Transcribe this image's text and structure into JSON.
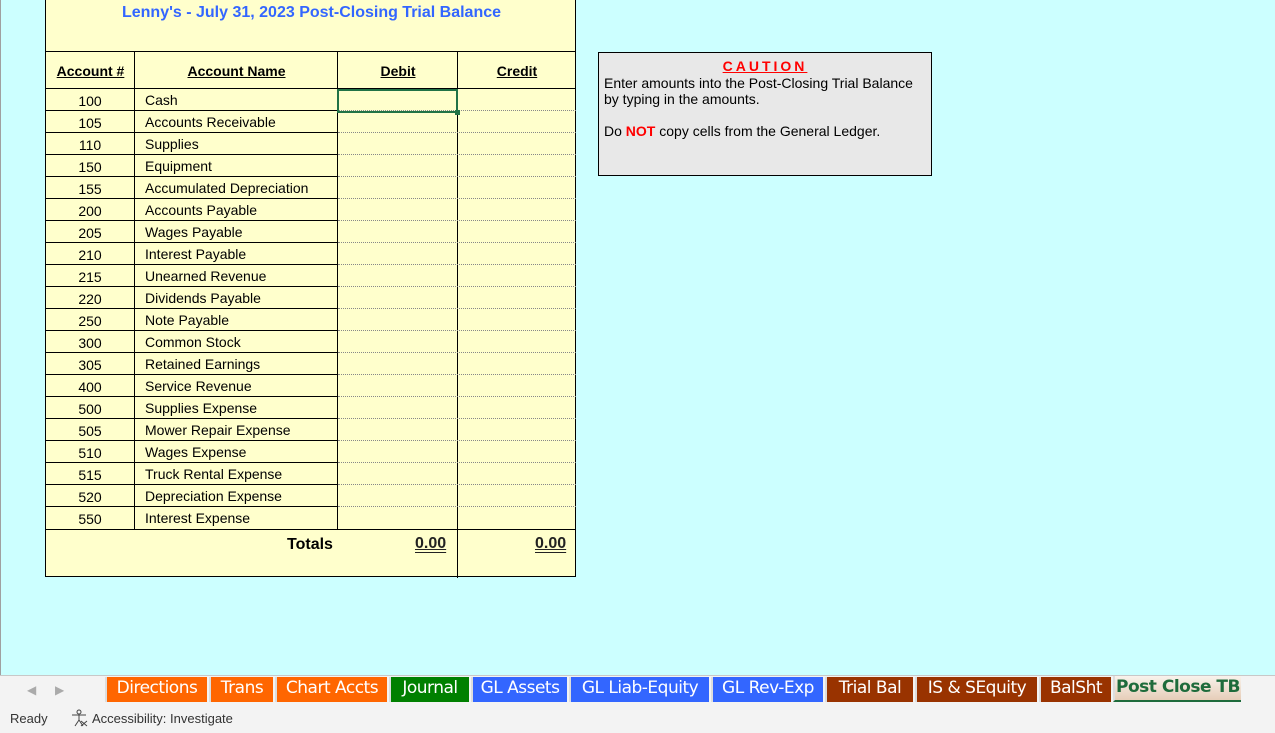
{
  "sheet": {
    "title": "Lenny's  -  July 31, 2023  Post-Closing Trial Balance",
    "headers": {
      "account_num": "Account #",
      "account_name": "Account Name",
      "debit": "Debit",
      "credit": "Credit"
    },
    "rows": [
      {
        "num": "100",
        "name": "Cash",
        "debit": "",
        "credit": ""
      },
      {
        "num": "105",
        "name": "Accounts Receivable",
        "debit": "",
        "credit": ""
      },
      {
        "num": "110",
        "name": "Supplies",
        "debit": "",
        "credit": ""
      },
      {
        "num": "150",
        "name": "Equipment",
        "debit": "",
        "credit": ""
      },
      {
        "num": "155",
        "name": "Accumulated Depreciation",
        "debit": "",
        "credit": ""
      },
      {
        "num": "200",
        "name": "Accounts Payable",
        "debit": "",
        "credit": ""
      },
      {
        "num": "205",
        "name": "Wages Payable",
        "debit": "",
        "credit": ""
      },
      {
        "num": "210",
        "name": "Interest Payable",
        "debit": "",
        "credit": ""
      },
      {
        "num": "215",
        "name": "Unearned Revenue",
        "debit": "",
        "credit": ""
      },
      {
        "num": "220",
        "name": "Dividends Payable",
        "debit": "",
        "credit": ""
      },
      {
        "num": "250",
        "name": "Note Payable",
        "debit": "",
        "credit": ""
      },
      {
        "num": "300",
        "name": "Common Stock",
        "debit": "",
        "credit": ""
      },
      {
        "num": "305",
        "name": "Retained Earnings",
        "debit": "",
        "credit": ""
      },
      {
        "num": "400",
        "name": "Service Revenue",
        "debit": "",
        "credit": ""
      },
      {
        "num": "500",
        "name": "Supplies Expense",
        "debit": "",
        "credit": ""
      },
      {
        "num": "505",
        "name": "Mower Repair Expense",
        "debit": "",
        "credit": ""
      },
      {
        "num": "510",
        "name": "Wages Expense",
        "debit": "",
        "credit": ""
      },
      {
        "num": "515",
        "name": "Truck Rental Expense",
        "debit": "",
        "credit": ""
      },
      {
        "num": "520",
        "name": "Depreciation Expense",
        "debit": "",
        "credit": ""
      },
      {
        "num": "550",
        "name": "Interest Expense",
        "debit": "",
        "credit": ""
      }
    ],
    "totals_label": "Totals",
    "total_debit": "0.00",
    "total_credit": "0.00"
  },
  "caution": {
    "title": "CAUTION",
    "line1": "Enter amounts into the Post-Closing Trial Balance by typing in the amounts.",
    "line2_pre": "Do ",
    "line2_emph": "NOT",
    "line2_post": " copy cells from the General Ledger."
  },
  "tabs": [
    {
      "label": "Directions",
      "color": "#ff6600"
    },
    {
      "label": "Trans",
      "color": "#ff6600"
    },
    {
      "label": "Chart Accts",
      "color": "#ff6600"
    },
    {
      "label": "Journal",
      "color": "#008000"
    },
    {
      "label": "GL Assets",
      "color": "#3366ff"
    },
    {
      "label": "GL Liab-Equity",
      "color": "#3366ff"
    },
    {
      "label": "GL Rev-Exp",
      "color": "#3366ff"
    },
    {
      "label": "Trial Bal",
      "color": "#993300"
    },
    {
      "label": "IS & SEquity",
      "color": "#993300"
    },
    {
      "label": "BalSht",
      "color": "#993300"
    },
    {
      "label": "Post Close TB",
      "color": "#1e6b3b",
      "active": true
    }
  ],
  "status": {
    "ready": "Ready",
    "accessibility": "Accessibility: Investigate"
  }
}
